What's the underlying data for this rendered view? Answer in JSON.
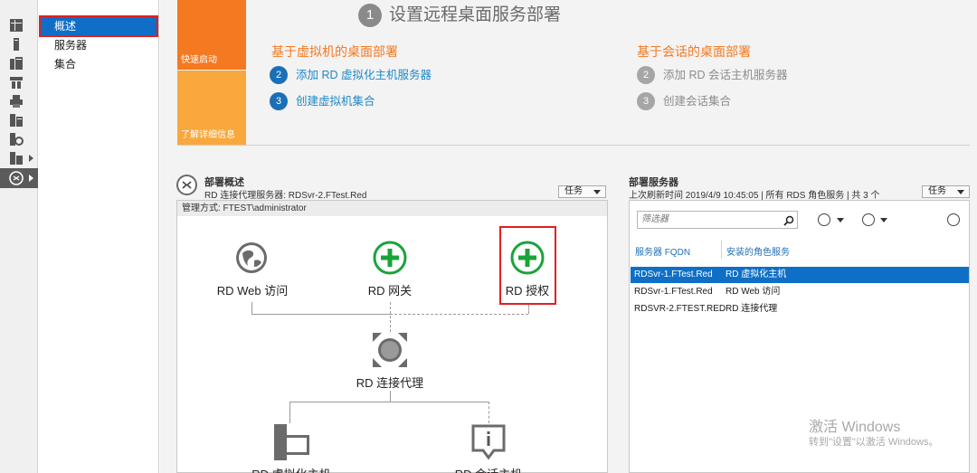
{
  "nav": {
    "items": [
      {
        "label": "概述"
      },
      {
        "label": "服务器"
      },
      {
        "label": "集合"
      }
    ]
  },
  "iconbar": {
    "icons": [
      "dashboard-icon",
      "server-icon",
      "servers-icon",
      "file-storage-icon",
      "print-icon",
      "rds-icon",
      "iis-icon",
      "ad-icon",
      "remote-desktop-icon"
    ]
  },
  "quickstart": {
    "tile_quick": "快速启动",
    "tile_learn": "了解详细信息",
    "step_num": "1",
    "step_title": "设置远程桌面服务部署",
    "vm_heading": "基于虚拟机的桌面部署",
    "vm_links": [
      {
        "num": "2",
        "label": "添加 RD 虚拟化主机服务器"
      },
      {
        "num": "3",
        "label": "创建虚拟机集合"
      }
    ],
    "session_heading": "基于会话的桌面部署",
    "session_links": [
      {
        "num": "2",
        "label": "添加 RD 会话主机服务器"
      },
      {
        "num": "3",
        "label": "创建会话集合"
      }
    ]
  },
  "overview": {
    "title": "部署概述",
    "subtitle": "RD 连接代理服务器: RDSvr-2.FTest.Red",
    "tasks": "任务",
    "managed_by": "管理方式: FTEST\\administrator",
    "roles": {
      "web": "RD Web 访问",
      "gateway": "RD 网关",
      "licensing": "RD 授权",
      "broker": "RD 连接代理",
      "virt_host": "RD 虚拟化主机",
      "session_host": "RD 会话主机"
    }
  },
  "servers": {
    "title": "部署服务器",
    "subtitle": "上次刷新时间 2019/4/9 10:45:05 | 所有 RDS 角色服务 | 共 3 个",
    "tasks": "任务",
    "filter_placeholder": "筛选器",
    "columns": [
      "服务器 FQDN",
      "安装的角色服务"
    ],
    "rows": [
      {
        "fqdn": "RDSvr-1.FTest.Red",
        "role": "RD 虚拟化主机",
        "selected": true
      },
      {
        "fqdn": "RDSvr-1.FTest.Red",
        "role": "RD Web 访问",
        "selected": false
      },
      {
        "fqdn": "RDSVR-2.FTEST.RED",
        "role": "RD 连接代理",
        "selected": false
      }
    ]
  },
  "watermark": {
    "line1": "激活 Windows",
    "line2": "转到\"设置\"以激活 Windows。"
  },
  "colors": {
    "accent": "#0f6fc6",
    "orange": "#f47920",
    "highlight": "#e02020",
    "green": "#1aa33a"
  }
}
